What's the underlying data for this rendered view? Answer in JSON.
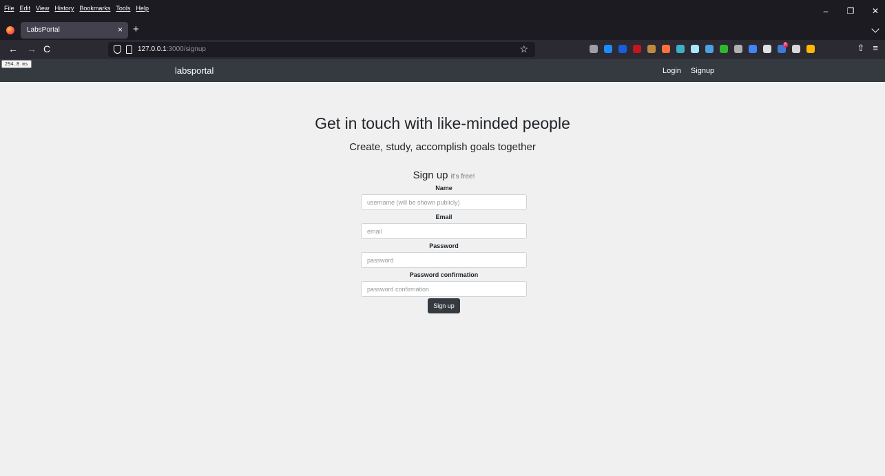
{
  "browser": {
    "menu": [
      "File",
      "Edit",
      "View",
      "History",
      "Bookmarks",
      "Tools",
      "Help"
    ],
    "window_controls": {
      "minimize": "–",
      "restore": "❐",
      "close": "✕"
    },
    "tab": {
      "title": "LabsPortal",
      "close": "×"
    },
    "new_tab": "+",
    "nav": {
      "back": "←",
      "forward": "→",
      "reload": "C"
    },
    "url": {
      "host": "127.0.0.1",
      "path": ":3000/signup"
    },
    "bookmark_star": "☆",
    "extensions": [
      {
        "name": "pocket-icon",
        "color": "#9e9ea6"
      },
      {
        "name": "onepassword-icon",
        "color": "#1a8cff"
      },
      {
        "name": "bitwarden-icon",
        "color": "#175ddc"
      },
      {
        "name": "ublock-icon",
        "color": "#c4161c"
      },
      {
        "name": "cookie-icon",
        "color": "#c08a3e"
      },
      {
        "name": "fox-extension-icon",
        "color": "#ff7139"
      },
      {
        "name": "wave-extension-icon",
        "color": "#3fb0c4"
      },
      {
        "name": "react-devtools-icon",
        "color": "#a6e6ff"
      },
      {
        "name": "screen-extension-icon",
        "color": "#4aa3df"
      },
      {
        "name": "green-extension-icon",
        "color": "#2eb82e"
      },
      {
        "name": "globe-extension-icon",
        "color": "#b0b0b0"
      },
      {
        "name": "translate-extension-icon",
        "color": "#4285f4"
      },
      {
        "name": "speaker-extension-icon",
        "color": "#e0e0e0"
      },
      {
        "name": "badge-extension-icon",
        "color": "#3d7bd9"
      },
      {
        "name": "chart-extension-icon",
        "color": "#d8d8d8"
      },
      {
        "name": "colorful-extension-icon",
        "color": "#ffb700"
      }
    ],
    "extensions_badge": "8",
    "right_tools": {
      "share": "⇧",
      "menu": "≡"
    },
    "timer_badge": "294.8 ms"
  },
  "site": {
    "brand": "labsportal",
    "nav_links": [
      "Login",
      "Signup"
    ]
  },
  "hero": {
    "title": "Get in touch with like-minded people",
    "subtitle": "Create, study, accomplish goals together"
  },
  "form": {
    "heading": "Sign up",
    "heading_note": "it's free!",
    "fields": [
      {
        "label": "Name",
        "placeholder": "username (will be shown publicly)"
      },
      {
        "label": "Email",
        "placeholder": "email"
      },
      {
        "label": "Password",
        "placeholder": "password"
      },
      {
        "label": "Password confirmation",
        "placeholder": "password confirmation"
      }
    ],
    "submit_label": "Sign up"
  }
}
